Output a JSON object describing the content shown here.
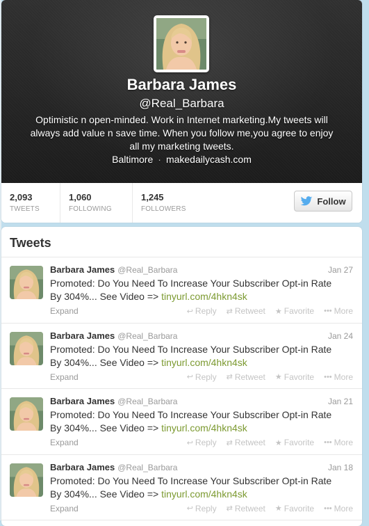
{
  "profile": {
    "name": "Barbara James",
    "handle": "@Real_Barbara",
    "bio": "Optimistic n open-minded. Work in Internet marketing.My tweets will always add value n save time. When you follow me,you agree to enjoy all my marketing tweets.",
    "location": "Baltimore",
    "separator": "·",
    "website": "makedailycash.com",
    "avatar_icon": "profile-photo"
  },
  "stats": [
    {
      "value": "2,093",
      "label": "TWEETS"
    },
    {
      "value": "1,060",
      "label": "FOLLOWING"
    },
    {
      "value": "1,245",
      "label": "FOLLOWERS"
    }
  ],
  "follow_button": {
    "label": "Follow",
    "icon": "twitter-bird-icon"
  },
  "tweets_section": {
    "title": "Tweets",
    "action_labels": {
      "reply": "Reply",
      "retweet": "Retweet",
      "favorite": "Favorite",
      "more": "More",
      "expand": "Expand"
    },
    "items": [
      {
        "name": "Barbara James",
        "handle": "@Real_Barbara",
        "date": "Jan 27",
        "text": "Promoted: Do You Need To Increase Your Subscriber Opt-in Rate By 304%... See Video => ",
        "link": "tinyurl.com/4hkn4sk"
      },
      {
        "name": "Barbara James",
        "handle": "@Real_Barbara",
        "date": "Jan 24",
        "text": "Promoted: Do You Need To Increase Your Subscriber Opt-in Rate By 304%... See Video => ",
        "link": "tinyurl.com/4hkn4sk"
      },
      {
        "name": "Barbara James",
        "handle": "@Real_Barbara",
        "date": "Jan 21",
        "text": "Promoted: Do You Need To Increase Your Subscriber Opt-in Rate By 304%... See Video => ",
        "link": "tinyurl.com/4hkn4sk"
      },
      {
        "name": "Barbara James",
        "handle": "@Real_Barbara",
        "date": "Jan 18",
        "text": "Promoted: Do You Need To Increase Your Subscriber Opt-in Rate By 304%... See Video => ",
        "link": "tinyurl.com/4hkn4sk"
      }
    ]
  },
  "colors": {
    "page_background": "#c0deed",
    "link": "#7c9a31",
    "header_background": "#262626",
    "follow_bird": "#55acee"
  }
}
